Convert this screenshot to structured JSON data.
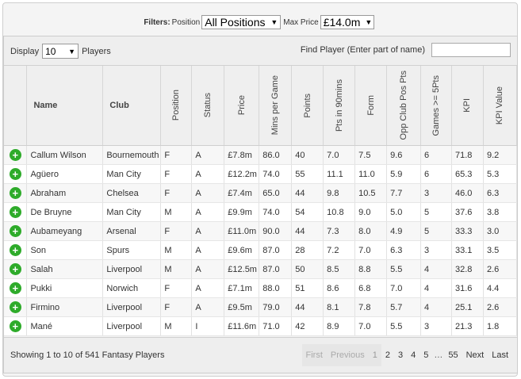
{
  "filters": {
    "title": "Filters:",
    "position_label": "Position",
    "position_value": "All Positions",
    "max_price_label": "Max Price",
    "max_price_value": "£14.0m"
  },
  "display": {
    "label": "Display",
    "value": "10",
    "suffix": "Players"
  },
  "find": {
    "label": "Find Player (Enter part of name)",
    "value": ""
  },
  "columns": [
    "Name",
    "Club",
    "Position",
    "Status",
    "Price",
    "Mins per Game",
    "Points",
    "Pts in 90mins",
    "Form",
    "Opp Club Pos Pts",
    "Games >= 5Pts",
    "KPI",
    "KPI Value"
  ],
  "add_symbol": "+",
  "rows": [
    [
      "Callum Wilson",
      "Bournemouth",
      "F",
      "A",
      "£7.8m",
      "86.0",
      "40",
      "7.0",
      "7.5",
      "9.6",
      "6",
      "71.8",
      "9.2"
    ],
    [
      "Agüero",
      "Man City",
      "F",
      "A",
      "£12.2m",
      "74.0",
      "55",
      "11.1",
      "11.0",
      "5.9",
      "6",
      "65.3",
      "5.3"
    ],
    [
      "Abraham",
      "Chelsea",
      "F",
      "A",
      "£7.4m",
      "65.0",
      "44",
      "9.8",
      "10.5",
      "7.7",
      "3",
      "46.0",
      "6.3"
    ],
    [
      "De Bruyne",
      "Man City",
      "M",
      "A",
      "£9.9m",
      "74.0",
      "54",
      "10.8",
      "9.0",
      "5.0",
      "5",
      "37.6",
      "3.8"
    ],
    [
      "Aubameyang",
      "Arsenal",
      "F",
      "A",
      "£11.0m",
      "90.0",
      "44",
      "7.3",
      "8.0",
      "4.9",
      "5",
      "33.3",
      "3.0"
    ],
    [
      "Son",
      "Spurs",
      "M",
      "A",
      "£9.6m",
      "87.0",
      "28",
      "7.2",
      "7.0",
      "6.3",
      "3",
      "33.1",
      "3.5"
    ],
    [
      "Salah",
      "Liverpool",
      "M",
      "A",
      "£12.5m",
      "87.0",
      "50",
      "8.5",
      "8.8",
      "5.5",
      "4",
      "32.8",
      "2.6"
    ],
    [
      "Pukki",
      "Norwich",
      "F",
      "A",
      "£7.1m",
      "88.0",
      "51",
      "8.6",
      "6.8",
      "7.0",
      "4",
      "31.6",
      "4.4"
    ],
    [
      "Firmino",
      "Liverpool",
      "F",
      "A",
      "£9.5m",
      "79.0",
      "44",
      "8.1",
      "7.8",
      "5.7",
      "4",
      "25.1",
      "2.6"
    ],
    [
      "Mané",
      "Liverpool",
      "M",
      "I",
      "£11.6m",
      "71.0",
      "42",
      "8.9",
      "7.0",
      "5.5",
      "3",
      "21.3",
      "1.8"
    ]
  ],
  "footer": {
    "showing": "Showing 1 to 10 of 541 Fantasy Players",
    "pager": {
      "first": "First",
      "previous": "Previous",
      "pages": [
        "1",
        "2",
        "3",
        "4",
        "5"
      ],
      "ellipsis": "…",
      "last_page": "55",
      "next": "Next",
      "last": "Last"
    }
  },
  "colors": {
    "add_button": "#2eab2a"
  }
}
